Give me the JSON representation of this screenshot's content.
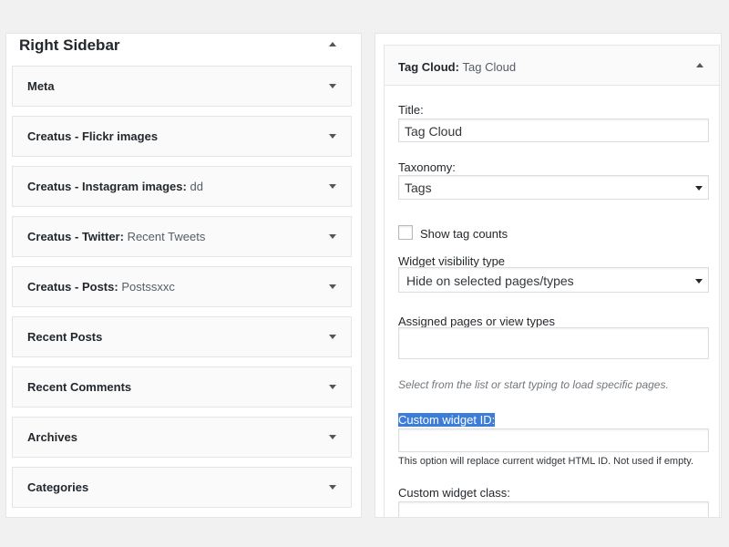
{
  "sidebar": {
    "title": "Right Sidebar",
    "widgets": [
      {
        "name": "Meta",
        "sub": ""
      },
      {
        "name": "Creatus - Flickr images",
        "sub": ""
      },
      {
        "name": "Creatus - Instagram images:",
        "sub": "dd"
      },
      {
        "name": "Creatus - Twitter:",
        "sub": "Recent Tweets"
      },
      {
        "name": "Creatus - Posts:",
        "sub": "Postssxxc"
      },
      {
        "name": "Recent Posts",
        "sub": ""
      },
      {
        "name": "Recent Comments",
        "sub": ""
      },
      {
        "name": "Archives",
        "sub": ""
      },
      {
        "name": "Categories",
        "sub": ""
      }
    ]
  },
  "editor": {
    "widget_name": "Tag Cloud:",
    "widget_title": "Tag Cloud",
    "title_label": "Title:",
    "title_value": "Tag Cloud",
    "taxonomy_label": "Taxonomy:",
    "taxonomy_value": "Tags",
    "show_counts_label": "Show tag counts",
    "show_counts_checked": false,
    "visibility_label": "Widget visibility type",
    "visibility_value": "Hide on selected pages/types",
    "assigned_label": "Assigned pages or view types",
    "assigned_value": "",
    "assigned_hint": "Select from the list or start typing to load specific pages.",
    "custom_id_label": "Custom widget ID:",
    "custom_id_value": "",
    "custom_id_hint": "This option will replace current widget HTML ID. Not used if empty.",
    "custom_class_label": "Custom widget class:",
    "custom_class_value": ""
  }
}
